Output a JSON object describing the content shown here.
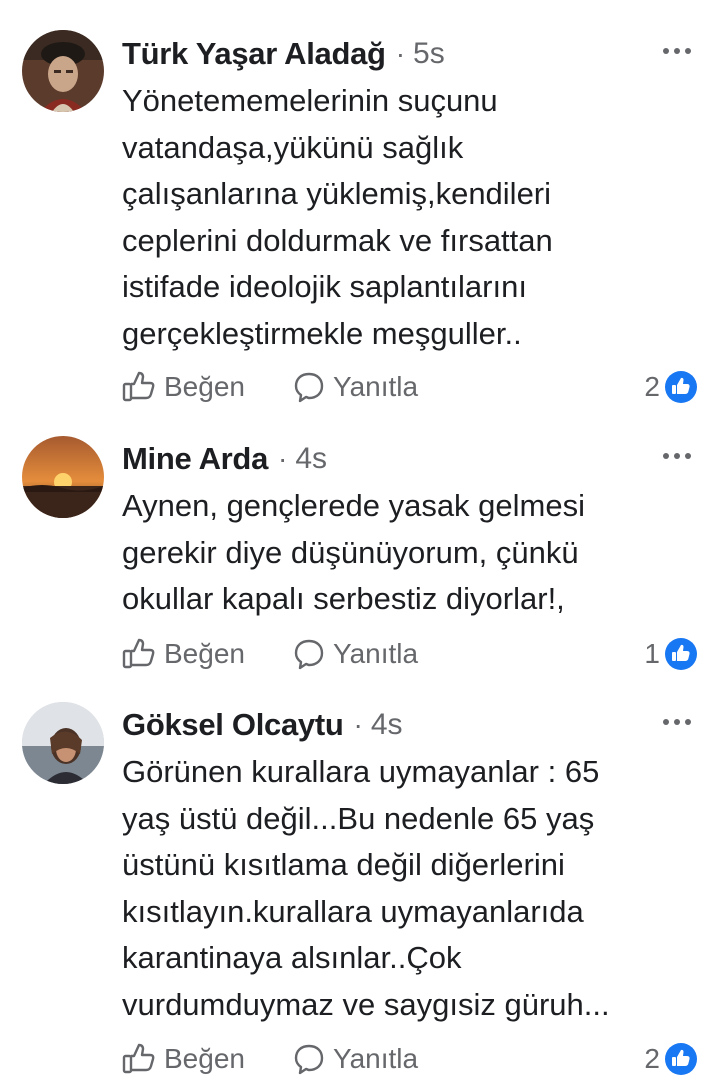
{
  "colors": {
    "text": "#1c1e21",
    "secondary": "#65676b",
    "like_blue": "#1877f2"
  },
  "icons": {
    "like": "thumbs-up-outline-icon",
    "reply": "speech-bubble-icon",
    "more": "three-dots-icon",
    "reaction": "blue-like-reaction-icon"
  },
  "actions": {
    "like_label": "Beğen",
    "reply_label": "Yanıtla",
    "separator": "·"
  },
  "comments": [
    {
      "author": "Türk Yaşar Aladağ",
      "time": "5s",
      "text": "Yönetememelerinin suçunu\nvatandaşa,yükünü sağlık\nçalışanlarına yüklemiş,kendileri\nceplerini doldurmak ve fırsattan\nistifade ideolojik saplantılarını\ngerçekleştirmekle meşguller..",
      "reaction_count": "2"
    },
    {
      "author": "Mine Arda",
      "time": "4s",
      "text": "Aynen, gençlerede yasak gelmesi\ngerekir diye düşünüyorum, çünkü\nokullar kapalı serbestiz diyorlar!,",
      "reaction_count": "1"
    },
    {
      "author": "Göksel Olcaytu",
      "time": "4s",
      "text": "Görünen kurallara uymayanlar : 65\nyaş üstü değil...Bu nedenle 65 yaş\nüstünü  kısıtlama değil diğerlerini\nkısıtlayın.kurallara uymayanlarıda\nkarantinaya alsınlar..Çok\nvurdumduymaz ve saygısiz güruh...",
      "reaction_count": "2"
    }
  ]
}
